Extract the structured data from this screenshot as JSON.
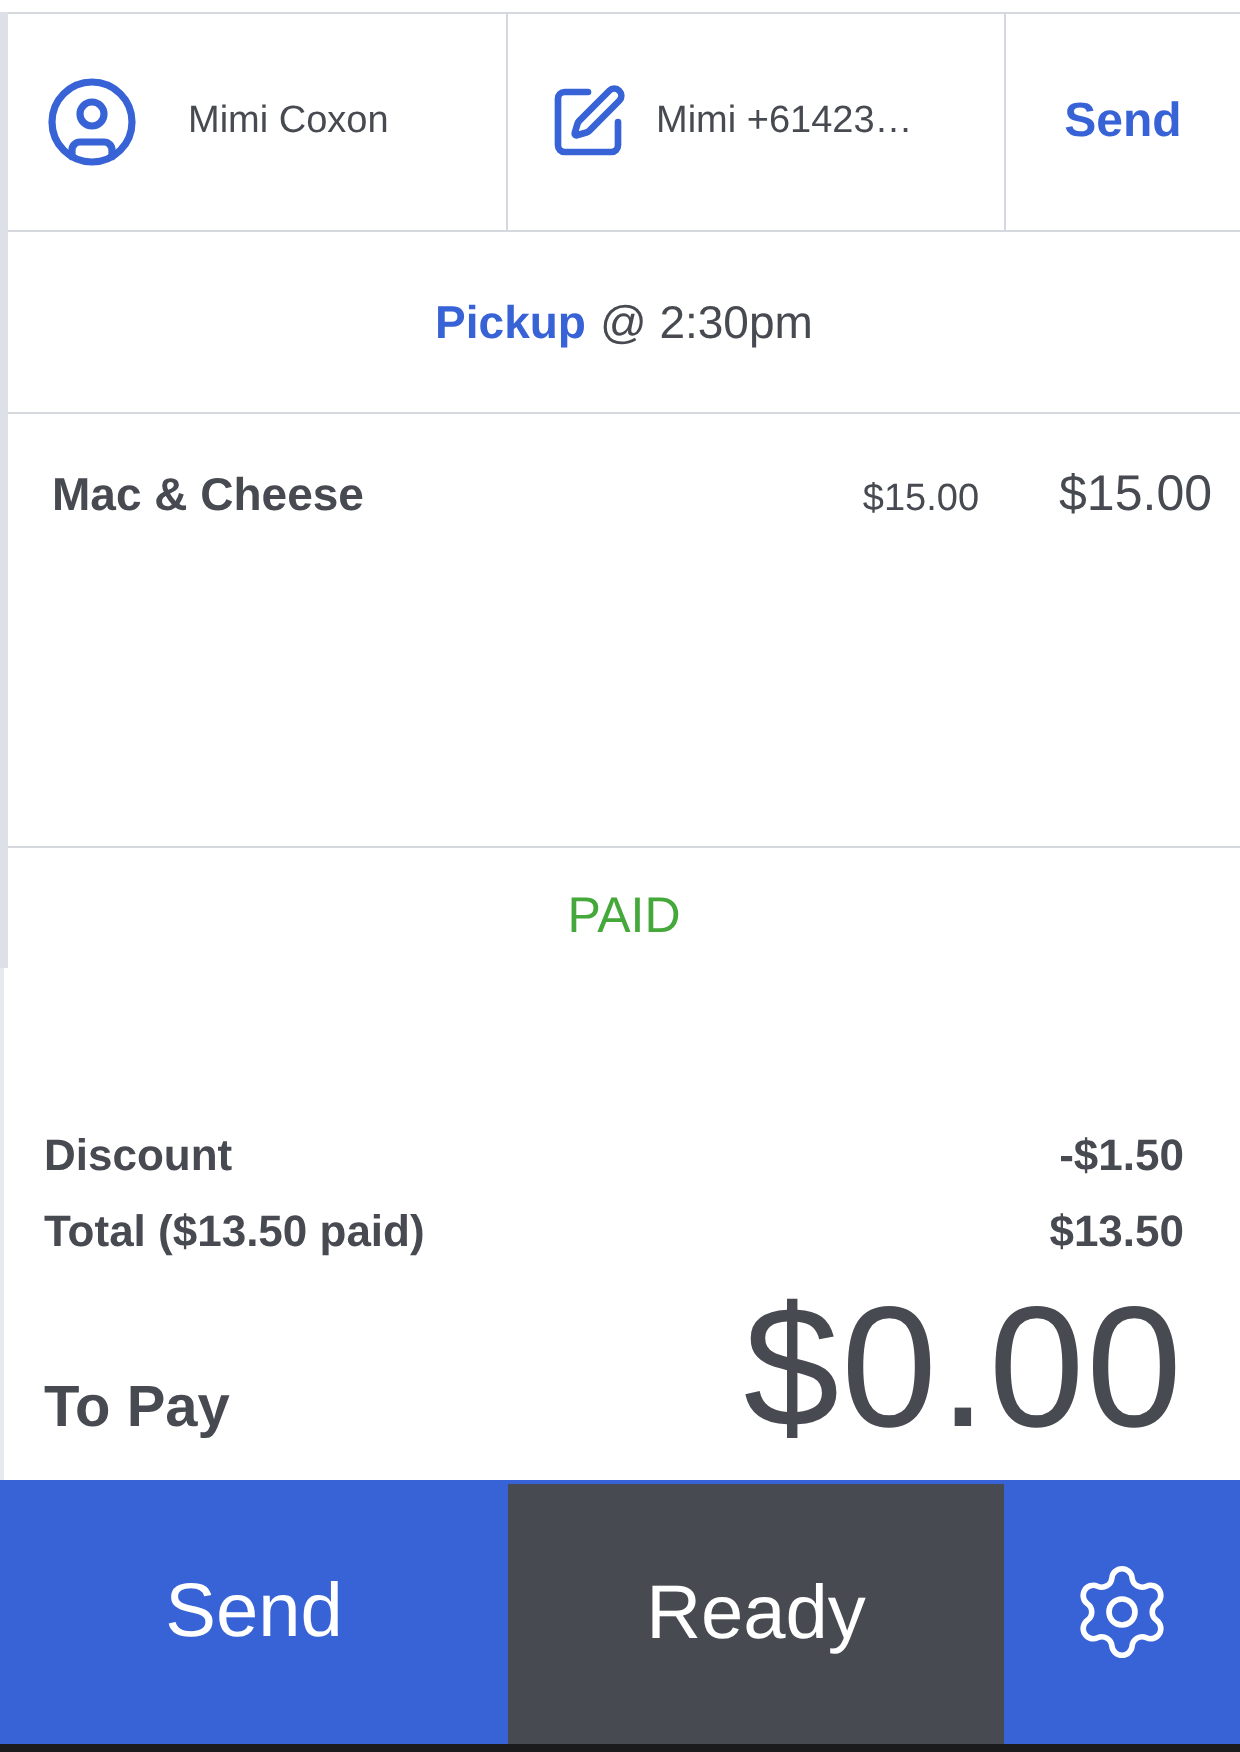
{
  "customer": {
    "name": "Mimi Coxon"
  },
  "note": {
    "text": "Mimi +61423…"
  },
  "send_link": {
    "label": "Send"
  },
  "fulfilment": {
    "method": "Pickup",
    "time": "@ 2:30pm"
  },
  "items": [
    {
      "name": "Mac & Cheese",
      "unit_price": "$15.00",
      "line_total": "$15.00"
    }
  ],
  "payment_status": {
    "label": "PAID",
    "kind": "paid"
  },
  "summary": [
    {
      "label": "Discount",
      "value": "-$1.50"
    },
    {
      "label": "Total ($13.50 paid)",
      "value": "$13.50"
    }
  ],
  "to_pay": {
    "label": "To Pay",
    "amount": "$0.00"
  },
  "actions": [
    {
      "label": "Send",
      "kind": "primary"
    },
    {
      "label": "Ready",
      "kind": "dark"
    },
    {
      "kind": "settings"
    }
  ]
}
